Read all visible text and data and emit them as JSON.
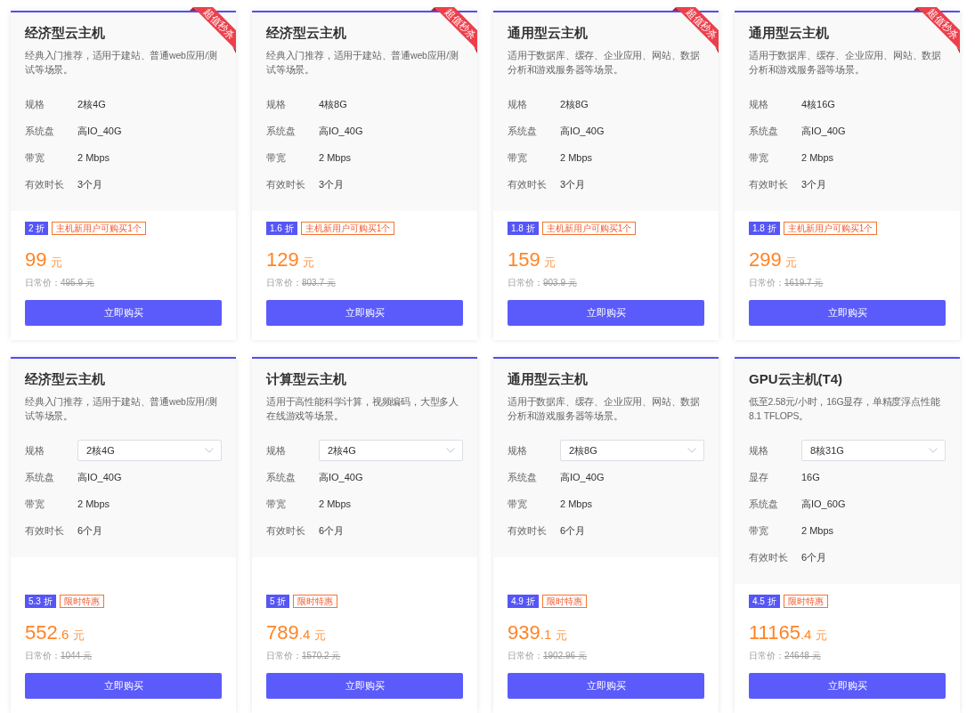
{
  "cards": [
    {
      "title": "经济型云主机",
      "description": "经典入门推荐，适用于建站、普通web应用/测试等场景。",
      "ribbon": "超值秒杀",
      "specs": [
        {
          "label": "规格",
          "value": "2核4G",
          "kind": "text"
        },
        {
          "label": "系统盘",
          "value": "高IO_40G",
          "kind": "text"
        },
        {
          "label": "带宽",
          "value": "2 Mbps",
          "kind": "text"
        },
        {
          "label": "有效时长",
          "value": "3个月",
          "kind": "text"
        }
      ],
      "discount": "2 折",
      "tag": "主机新用户可购买1个",
      "price": {
        "integer": "99",
        "unit": "元"
      },
      "regular_price": {
        "label": "日常价：",
        "value": "495.9 元"
      },
      "button": "立即购买"
    },
    {
      "title": "经济型云主机",
      "description": "经典入门推荐，适用于建站、普通web应用/测试等场景。",
      "ribbon": "超值秒杀",
      "specs": [
        {
          "label": "规格",
          "value": "4核8G",
          "kind": "text"
        },
        {
          "label": "系统盘",
          "value": "高IO_40G",
          "kind": "text"
        },
        {
          "label": "带宽",
          "value": "2 Mbps",
          "kind": "text"
        },
        {
          "label": "有效时长",
          "value": "3个月",
          "kind": "text"
        }
      ],
      "discount": "1.6 折",
      "tag": "主机新用户可购买1个",
      "price": {
        "integer": "129",
        "unit": "元"
      },
      "regular_price": {
        "label": "日常价：",
        "value": "803.7 元"
      },
      "button": "立即购买"
    },
    {
      "title": "通用型云主机",
      "description": "适用于数据库、缓存、企业应用、网站、数据分析和游戏服务器等场景。",
      "ribbon": "超值秒杀",
      "specs": [
        {
          "label": "规格",
          "value": "2核8G",
          "kind": "text"
        },
        {
          "label": "系统盘",
          "value": "高IO_40G",
          "kind": "text"
        },
        {
          "label": "带宽",
          "value": "2 Mbps",
          "kind": "text"
        },
        {
          "label": "有效时长",
          "value": "3个月",
          "kind": "text"
        }
      ],
      "discount": "1.8 折",
      "tag": "主机新用户可购买1个",
      "price": {
        "integer": "159",
        "unit": "元"
      },
      "regular_price": {
        "label": "日常价：",
        "value": "903.9 元"
      },
      "button": "立即购买"
    },
    {
      "title": "通用型云主机",
      "description": "适用于数据库、缓存、企业应用、网站、数据分析和游戏服务器等场景。",
      "ribbon": "超值秒杀",
      "specs": [
        {
          "label": "规格",
          "value": "4核16G",
          "kind": "text"
        },
        {
          "label": "系统盘",
          "value": "高IO_40G",
          "kind": "text"
        },
        {
          "label": "带宽",
          "value": "2 Mbps",
          "kind": "text"
        },
        {
          "label": "有效时长",
          "value": "3个月",
          "kind": "text"
        }
      ],
      "discount": "1.8 折",
      "tag": "主机新用户可购买1个",
      "price": {
        "integer": "299",
        "unit": "元"
      },
      "regular_price": {
        "label": "日常价：",
        "value": "1619.7 元"
      },
      "button": "立即购买"
    },
    {
      "title": "经济型云主机",
      "description": "经典入门推荐，适用于建站、普通web应用/测试等场景。",
      "specs": [
        {
          "label": "规格",
          "value": "2核4G",
          "kind": "select"
        },
        {
          "label": "系统盘",
          "value": "高IO_40G",
          "kind": "text"
        },
        {
          "label": "带宽",
          "value": "2 Mbps",
          "kind": "text"
        },
        {
          "label": "有效时长",
          "value": "6个月",
          "kind": "text"
        }
      ],
      "discount": "5.3 折",
      "tag": "限时特惠",
      "price": {
        "integer": "552",
        "decimal": ".6",
        "unit": "元"
      },
      "regular_price": {
        "label": "日常价：",
        "value": "1044 元"
      },
      "button": "立即购买"
    },
    {
      "title": "计算型云主机",
      "description": "适用于高性能科学计算，视频编码，大型多人在线游戏等场景。",
      "specs": [
        {
          "label": "规格",
          "value": "2核4G",
          "kind": "select"
        },
        {
          "label": "系统盘",
          "value": "高IO_40G",
          "kind": "text"
        },
        {
          "label": "带宽",
          "value": "2 Mbps",
          "kind": "text"
        },
        {
          "label": "有效时长",
          "value": "6个月",
          "kind": "text"
        }
      ],
      "discount": "5 折",
      "tag": "限时特惠",
      "price": {
        "integer": "789",
        "decimal": ".4",
        "unit": "元"
      },
      "regular_price": {
        "label": "日常价：",
        "value": "1570.2 元"
      },
      "button": "立即购买"
    },
    {
      "title": "通用型云主机",
      "description": "适用于数据库、缓存、企业应用、网站、数据分析和游戏服务器等场景。",
      "specs": [
        {
          "label": "规格",
          "value": "2核8G",
          "kind": "select"
        },
        {
          "label": "系统盘",
          "value": "高IO_40G",
          "kind": "text"
        },
        {
          "label": "带宽",
          "value": "2 Mbps",
          "kind": "text"
        },
        {
          "label": "有效时长",
          "value": "6个月",
          "kind": "text"
        }
      ],
      "discount": "4.9 折",
      "tag": "限时特惠",
      "price": {
        "integer": "939",
        "decimal": ".1",
        "unit": "元"
      },
      "regular_price": {
        "label": "日常价：",
        "value": "1902.96 元"
      },
      "button": "立即购买"
    },
    {
      "title": "GPU云主机(T4)",
      "description": "低至2.58元/小时，16G显存，单精度浮点性能8.1 TFLOPS。",
      "specs": [
        {
          "label": "规格",
          "value": "8核31G",
          "kind": "select"
        },
        {
          "label": "显存",
          "value": "16G",
          "kind": "text"
        },
        {
          "label": "系统盘",
          "value": "高IO_60G",
          "kind": "text"
        },
        {
          "label": "带宽",
          "value": "2 Mbps",
          "kind": "text"
        },
        {
          "label": "有效时长",
          "value": "6个月",
          "kind": "text"
        }
      ],
      "discount": "4.5 折",
      "tag": "限时特惠",
      "price": {
        "integer": "11165",
        "decimal": ".4",
        "unit": "元"
      },
      "regular_price": {
        "label": "日常价：",
        "value": "24648 元"
      },
      "button": "立即购买"
    }
  ]
}
